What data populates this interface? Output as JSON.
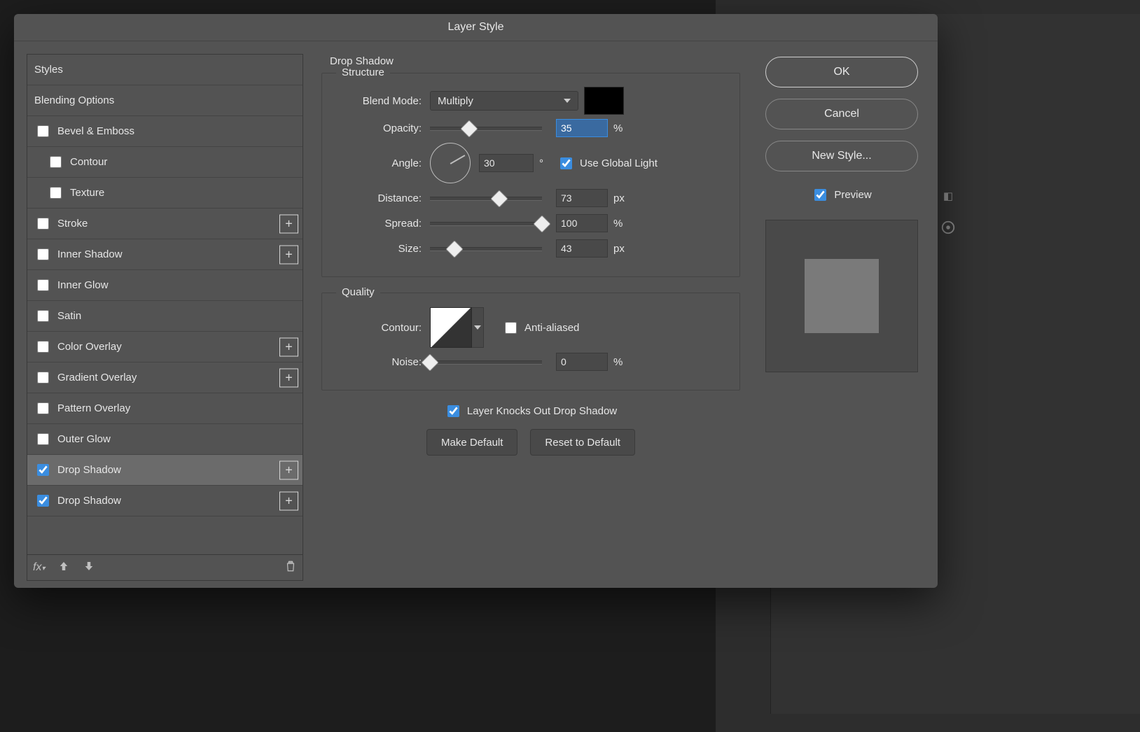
{
  "dialog_title": "Layer Style",
  "styles_header": "Styles",
  "blending_options": "Blending Options",
  "effects": {
    "bevel_emboss": "Bevel & Emboss",
    "contour": "Contour",
    "texture": "Texture",
    "stroke": "Stroke",
    "inner_shadow": "Inner Shadow",
    "inner_glow": "Inner Glow",
    "satin": "Satin",
    "color_overlay": "Color Overlay",
    "gradient_overlay": "Gradient Overlay",
    "pattern_overlay": "Pattern Overlay",
    "outer_glow": "Outer Glow",
    "drop_shadow_1": "Drop Shadow",
    "drop_shadow_2": "Drop Shadow"
  },
  "panel_title": "Drop Shadow",
  "structure": {
    "legend": "Structure",
    "blend_mode_label": "Blend Mode:",
    "blend_mode_value": "Multiply",
    "blend_color": "#000000",
    "opacity_label": "Opacity:",
    "opacity_value": "35",
    "opacity_unit": "%",
    "angle_label": "Angle:",
    "angle_value": "30",
    "angle_unit": "°",
    "global_light_label": "Use Global Light",
    "distance_label": "Distance:",
    "distance_value": "73",
    "distance_unit": "px",
    "spread_label": "Spread:",
    "spread_value": "100",
    "spread_unit": "%",
    "size_label": "Size:",
    "size_value": "43",
    "size_unit": "px"
  },
  "quality": {
    "legend": "Quality",
    "contour_label": "Contour:",
    "anti_aliased_label": "Anti-aliased",
    "noise_label": "Noise:",
    "noise_value": "0",
    "noise_unit": "%"
  },
  "knockout_label": "Layer Knocks Out Drop Shadow",
  "make_default": "Make Default",
  "reset_default": "Reset to Default",
  "buttons": {
    "ok": "OK",
    "cancel": "Cancel",
    "new_style": "New Style..."
  },
  "preview_label": "Preview"
}
